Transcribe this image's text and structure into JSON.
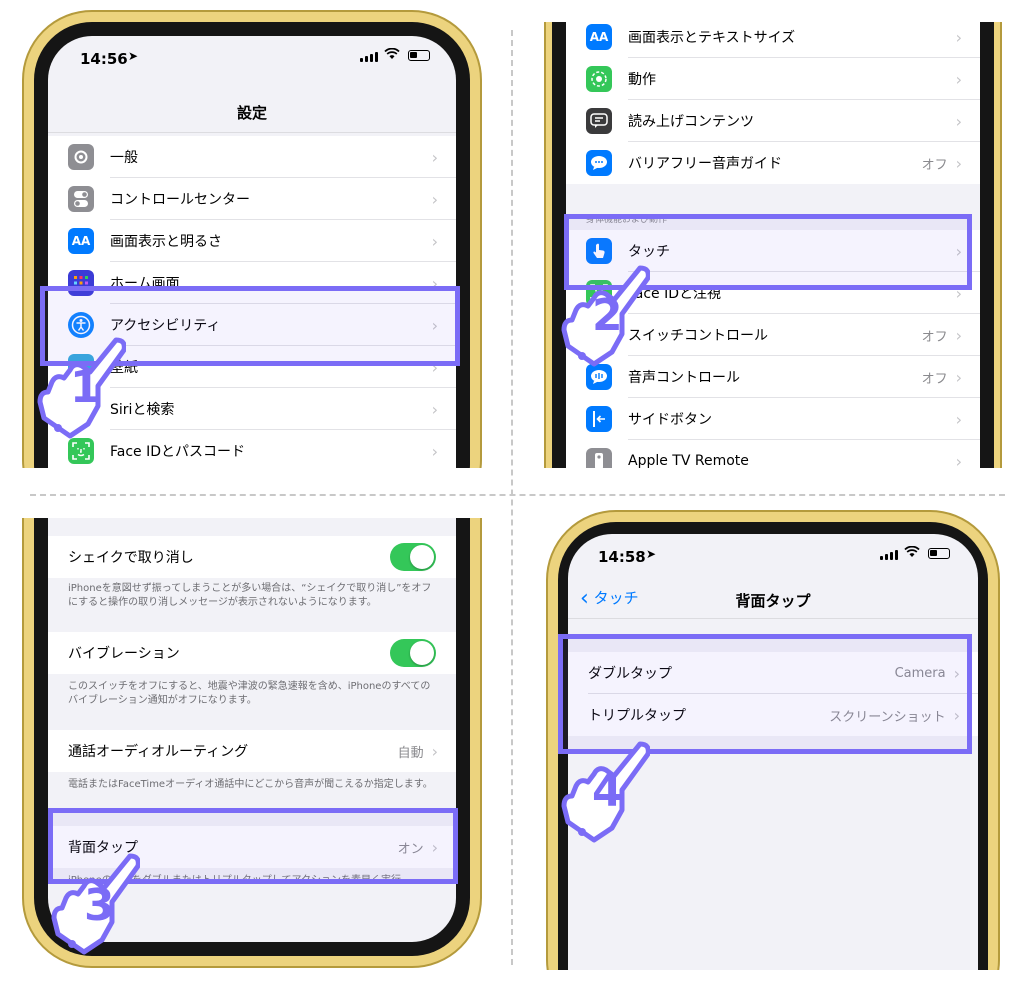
{
  "colors": {
    "highlight": "#7b6cf6",
    "ios_blue": "#007aff",
    "toggle_on": "#34c759",
    "gold_frame": "#ecd37e"
  },
  "panel1": {
    "time": "14:56",
    "title": "設定",
    "rows": [
      {
        "label": "一般",
        "icon": "gear-icon",
        "color": "#8e8e93"
      },
      {
        "label": "コントロールセンター",
        "icon": "toggles-icon",
        "color": "#8e8e93"
      },
      {
        "label": "画面表示と明るさ",
        "icon": "text-size-icon",
        "color": "#007aff",
        "glyph": "AA"
      },
      {
        "label": "ホーム画面",
        "icon": "home-grid-icon",
        "color": "#3b3bd6"
      },
      {
        "label": "アクセシビリティ",
        "icon": "accessibility-icon",
        "color": "#0a84ff"
      },
      {
        "label": "壁紙",
        "icon": "wallpaper-icon",
        "color": "#34aadc"
      },
      {
        "label": "Siriと検索",
        "icon": "siri-icon",
        "color": "#222222"
      },
      {
        "label": "Face IDとパスコード",
        "icon": "face-id-icon",
        "color": "#34c759"
      }
    ],
    "step": "1"
  },
  "panel2": {
    "rows_top": [
      {
        "label": "画面表示とテキストサイズ",
        "icon": "text-size-icon",
        "color": "#007aff",
        "glyph": "AA"
      },
      {
        "label": "動作",
        "icon": "motion-icon",
        "color": "#34c759"
      },
      {
        "label": "読み上げコンテンツ",
        "icon": "spoken-content-icon",
        "color": "#3a3a3c"
      },
      {
        "label": "バリアフリー音声ガイド",
        "icon": "audio-description-icon",
        "color": "#007aff",
        "value": "オフ"
      }
    ],
    "section_header": "身体機能および動作",
    "rows_bottom": [
      {
        "label": "タッチ",
        "icon": "touch-hand-icon",
        "color": "#007aff"
      },
      {
        "label": "Face IDと注視",
        "icon": "face-id-icon",
        "color": "#34c759"
      },
      {
        "label": "スイッチコントロール",
        "icon": "switch-control-icon",
        "color": "#3a3a3c",
        "value": "オフ"
      },
      {
        "label": "音声コントロール",
        "icon": "voice-control-icon",
        "color": "#007aff",
        "value": "オフ"
      },
      {
        "label": "サイドボタン",
        "icon": "side-button-icon",
        "color": "#007aff"
      },
      {
        "label": "Apple TV Remote",
        "icon": "remote-icon",
        "color": "#8e8e93"
      }
    ],
    "step": "2"
  },
  "panel3": {
    "shake_label": "シェイクで取り消し",
    "shake_note": "iPhoneを意図せず振ってしまうことが多い場合は、“シェイクで取り消し”をオフにすると操作の取り消しメッセージが表示されないようになります。",
    "vibration_label": "バイブレーション",
    "vibration_note": "このスイッチをオフにすると、地震や津波の緊急速報を含め、iPhoneのすべてのバイブレーション通知がオフになります。",
    "audio_routing_label": "通話オーディオルーティング",
    "audio_routing_value": "自動",
    "audio_routing_note": "電話またはFaceTimeオーディオ通話中にどこから音声が聞こえるか指定します。",
    "back_tap_label": "背面タップ",
    "back_tap_value": "オン",
    "back_tap_note": "iPhoneの背面をダブルまたはトリプルタップしてアクションを素早く実行",
    "step": "3"
  },
  "panel4": {
    "time": "14:58",
    "back_label": "タッチ",
    "title": "背面タップ",
    "rows": [
      {
        "label": "ダブルタップ",
        "value": "Camera"
      },
      {
        "label": "トリプルタップ",
        "value": "スクリーンショット"
      }
    ],
    "step": "4"
  }
}
